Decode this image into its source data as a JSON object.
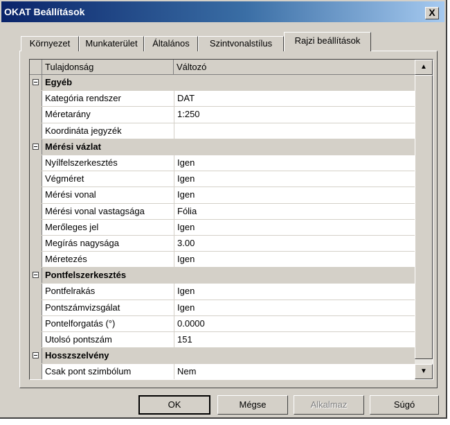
{
  "window": {
    "title": "OKAT Beállítások",
    "close_label": "X"
  },
  "tabs": [
    {
      "label": "Környezet"
    },
    {
      "label": "Munkaterület"
    },
    {
      "label": "Általános"
    },
    {
      "label": "Szintvonalstílus"
    },
    {
      "label": "Rajzi beállítások",
      "active": true
    }
  ],
  "grid": {
    "headers": {
      "property": "Tulajdonság",
      "value": "Változó"
    },
    "rows": [
      {
        "group": true,
        "label": "Egyéb"
      },
      {
        "label": "Kategória rendszer",
        "value": "DAT"
      },
      {
        "label": "Méretarány",
        "value": "1:250"
      },
      {
        "label": "Koordináta jegyzék",
        "value": ""
      },
      {
        "group": true,
        "label": "Mérési vázlat"
      },
      {
        "label": "Nyílfelszerkesztés",
        "value": "Igen"
      },
      {
        "label": "Végméret",
        "value": "Igen"
      },
      {
        "label": "Mérési vonal",
        "value": "Igen"
      },
      {
        "label": "Mérési vonal vastagsága",
        "value": "Fólia"
      },
      {
        "label": "Merőleges jel",
        "value": "Igen"
      },
      {
        "label": "Megírás nagysága",
        "value": "3.00"
      },
      {
        "label": "Méretezés",
        "value": "Igen"
      },
      {
        "group": true,
        "label": "Pontfelszerkesztés"
      },
      {
        "label": "Pontfelrakás",
        "value": "Igen"
      },
      {
        "label": "Pontszámvizsgálat",
        "value": "Igen"
      },
      {
        "label": "Pontelforgatás (°)",
        "value": "0.0000"
      },
      {
        "label": "Utolsó pontszám",
        "value": "151"
      },
      {
        "group": true,
        "label": "Hosszszelvény"
      },
      {
        "label": "Csak pont szimbólum",
        "value": "Nem"
      }
    ]
  },
  "buttons": {
    "ok": "OK",
    "cancel": "Mégse",
    "apply": "Alkalmaz",
    "help": "Súgó"
  }
}
